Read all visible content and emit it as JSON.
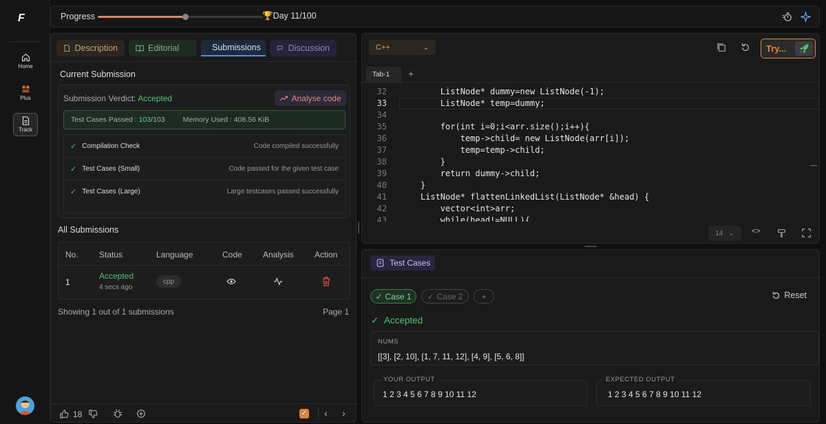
{
  "rail": {
    "logo": "F",
    "items": [
      {
        "label": "Home",
        "icon": "home-icon"
      },
      {
        "label": "Plus",
        "icon": "plus-icon"
      },
      {
        "label": "Track",
        "icon": "document-icon"
      }
    ]
  },
  "topbar": {
    "progress_label": "Progress",
    "progress_fraction": 0.11,
    "day_text": "Day 11/100"
  },
  "problem_tabs": [
    {
      "label": "Description",
      "icon": "document-icon"
    },
    {
      "label": "Editorial",
      "icon": "book-icon"
    },
    {
      "label": "Submissions",
      "icon": "clock-icon"
    },
    {
      "label": "Discussion",
      "icon": "chat-icon"
    }
  ],
  "current": {
    "heading": "Current Submission",
    "verdict_label": "Submission Verdict:",
    "verdict_value": "Accepted",
    "analyse_label": "Analyse code",
    "tests_label": "Test Cases Passed :",
    "tests_passed": "103",
    "tests_total": "/103",
    "memory_text": "Memory Used : 408.56 KiB",
    "checks": [
      {
        "name": "Compilation Check",
        "desc": "Code compiled successfully"
      },
      {
        "name": "Test Cases (Small)",
        "desc": "Code passed for the given test case"
      },
      {
        "name": "Test Cases (Large)",
        "desc": "Large testcases passed successfully"
      }
    ]
  },
  "all": {
    "heading": "All Submissions",
    "headers": [
      "No.",
      "Status",
      "Language",
      "Code",
      "Analysis",
      "Action"
    ],
    "rows": [
      {
        "no": "1",
        "status": "Accepted",
        "time": "4 secs ago",
        "language": "cpp"
      }
    ],
    "showing": "Showing 1 out of 1 submissions",
    "page": "Page 1"
  },
  "footer": {
    "likes": "18"
  },
  "editor": {
    "language": "C++",
    "try_label": "Try...",
    "tab": "Tab-1",
    "font_size": "14",
    "lines": [
      {
        "n": "32",
        "text": "        ListNode* dummy=new ListNode(-1);"
      },
      {
        "n": "33",
        "text": "        ListNode* temp=dummy;"
      },
      {
        "n": "34",
        "text": ""
      },
      {
        "n": "35",
        "text": "        for(int i=0;i<arr.size();i++){"
      },
      {
        "n": "36",
        "text": "            temp->child= new ListNode(arr[i]);"
      },
      {
        "n": "37",
        "text": "            temp=temp->child;"
      },
      {
        "n": "38",
        "text": "        }"
      },
      {
        "n": "39",
        "text": "        return dummy->child;"
      },
      {
        "n": "40",
        "text": "    }"
      },
      {
        "n": "41",
        "text": "    ListNode* flattenLinkedList(ListNode* &head) {"
      },
      {
        "n": "42",
        "text": "        vector<int>arr;"
      },
      {
        "n": "43",
        "text": "        while(head!=NULL){"
      }
    ]
  },
  "testcases": {
    "title": "Test Cases",
    "case1": "Case 1",
    "case2": "Case 2",
    "add": "+",
    "reset": "Reset",
    "result": "Accepted",
    "nums_label": "NUMS",
    "nums_value": "[[3], [2, 10], [1, 7, 11, 12], [4, 9], [5, 6, 8]]",
    "your_label": "YOUR OUTPUT",
    "your_value": "1 2 3 4 5 6 7 8 9 10 11 12",
    "expected_label": "EXPECTED OUTPUT",
    "expected_value": "1 2 3 4 5 6 7 8 9 10 11 12"
  },
  "colors": {
    "accent_green": "#4ec27a",
    "accent_orange": "#d98a3a",
    "accent_blue": "#5a8fd8"
  }
}
